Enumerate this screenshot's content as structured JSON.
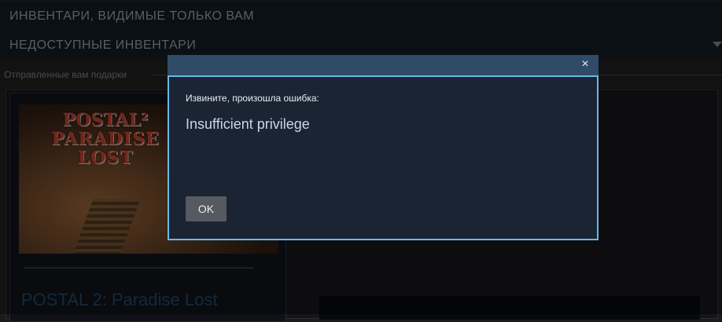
{
  "inventory_sections": [
    {
      "label": "ИНВЕНТАРИ, ВИДИМЫЕ ТОЛЬКО ВАМ"
    },
    {
      "label": "НЕДОСТУПНЫЕ ИНВЕНТАРИ"
    }
  ],
  "gifts": {
    "section_title": "Отправленные вам подарки",
    "items": [
      {
        "title": "POSTAL 2: Paradise Lost",
        "art_logo_line1": "POSTAL²",
        "art_logo_line2": "PARADISE LOST"
      }
    ]
  },
  "dialog": {
    "close_label": "×",
    "heading": "Извините, произошла ошибка:",
    "message": "Insufficient privilege",
    "ok_label": "OK"
  },
  "colors": {
    "dialog_border": "#67b9e8",
    "dialog_header": "#2f4b67",
    "dialog_body": "#1a2433",
    "ok_button": "#565a60"
  }
}
